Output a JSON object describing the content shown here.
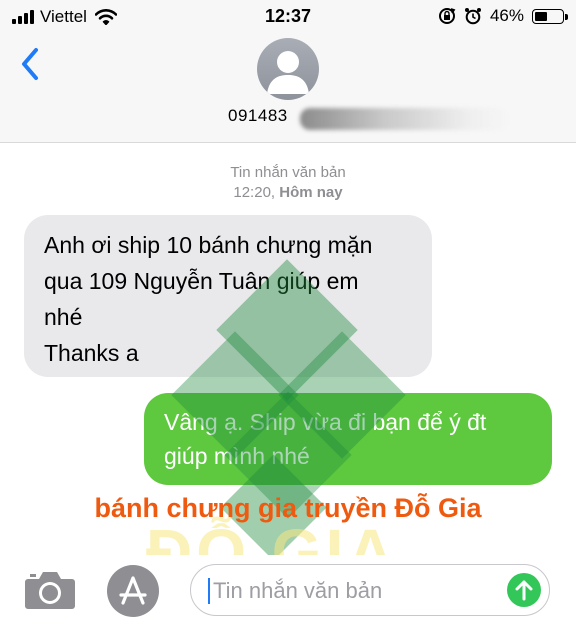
{
  "status_bar": {
    "carrier": "Viettel",
    "time": "12:37",
    "battery_percent": "46%",
    "battery_level": 0.46,
    "icons": [
      "signal-bars-icon",
      "wifi-icon",
      "rotation-lock-icon",
      "alarm-icon",
      "battery-icon"
    ]
  },
  "header": {
    "back_icon": "chevron-left-icon",
    "avatar_icon": "person-silhouette-icon",
    "phone_prefix": "091483"
  },
  "conversation": {
    "type_label": "Tin nhắn văn bản",
    "time": "12:20,",
    "day": "Hôm nay",
    "messages": [
      {
        "direction": "incoming",
        "lines": [
          "Anh ơi ship 10 bánh chưng mặn",
          "qua 109 Nguyễn Tuân giúp em",
          "nhé",
          "Thanks a"
        ]
      },
      {
        "direction": "outgoing",
        "lines": [
          "Vâng ạ. Ship vừa đi bạn để ý đt",
          "giúp mình nhé"
        ]
      }
    ]
  },
  "watermark": {
    "promo_text": "bánh chưng gia truyền Đỗ Gia",
    "logo_text": "ĐỖ GIA",
    "colors": {
      "diamond": "#1e8a3c",
      "promo": "#ee5a0f",
      "logo_text": "#f8e882"
    }
  },
  "input_bar": {
    "camera_icon": "camera-icon",
    "appstore_icon": "app-store-icon",
    "placeholder": "Tin nhắn văn bản",
    "send_icon": "send-arrow-up-icon"
  },
  "colors": {
    "accent": "#1f7bf6",
    "incoming_bubble": "#e9e9eb",
    "outgoing_bubble": "#5ec83f",
    "send_button": "#33c759"
  }
}
